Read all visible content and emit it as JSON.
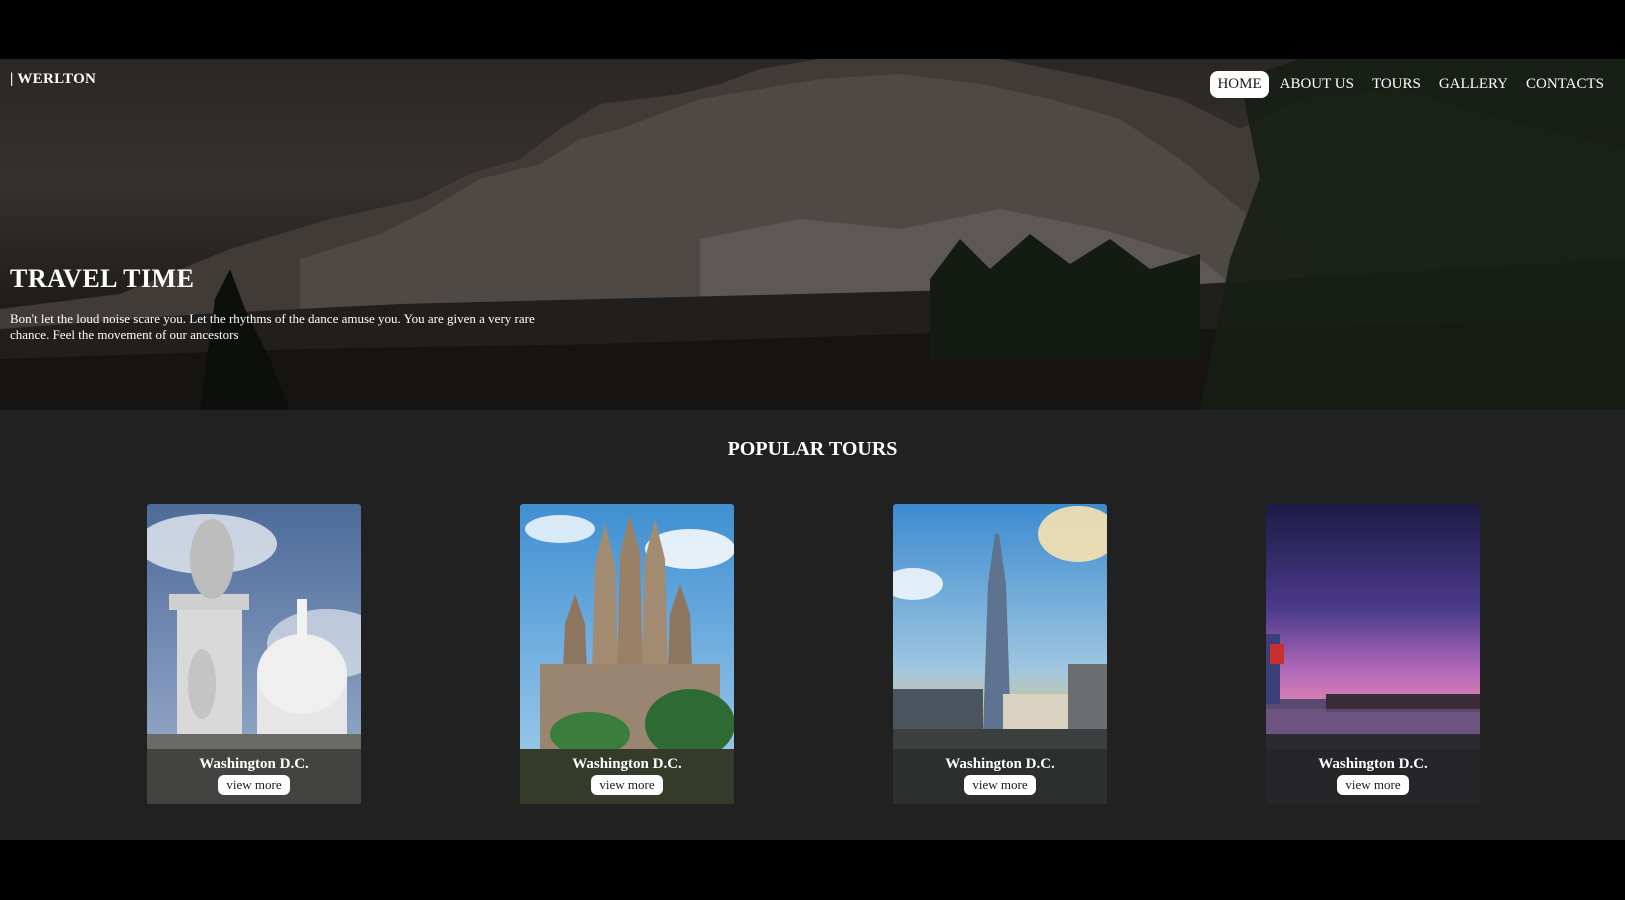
{
  "header": {
    "brand": "| WERLTON",
    "nav": [
      {
        "label": "HOME",
        "active": true
      },
      {
        "label": "ABOUT US",
        "active": false
      },
      {
        "label": "TOURS",
        "active": false
      },
      {
        "label": "GALLERY",
        "active": false
      },
      {
        "label": "CONTACTS",
        "active": false
      }
    ]
  },
  "hero": {
    "title": "TRAVEL TIME",
    "text": "Bon't let the loud noise scare you. Let the rhythms of the dance amuse you. You are given a very rare chance. Feel the movement of our ancestors"
  },
  "tours": {
    "title": "POPULAR TOURS",
    "cards": [
      {
        "title": "Washington D.C.",
        "button": "view more",
        "image": "capitol-statue-photo"
      },
      {
        "title": "Washington D.C.",
        "button": "view more",
        "image": "cathedral-photo"
      },
      {
        "title": "Washington D.C.",
        "button": "view more",
        "image": "skyscraper-city-photo"
      },
      {
        "title": "Washington D.C.",
        "button": "view more",
        "image": "harbor-sunset-photo"
      }
    ]
  },
  "colors": {
    "page_background": "#212121",
    "outer_background": "#000000",
    "active_nav_background": "#ffffff",
    "text": "#ffffff"
  }
}
